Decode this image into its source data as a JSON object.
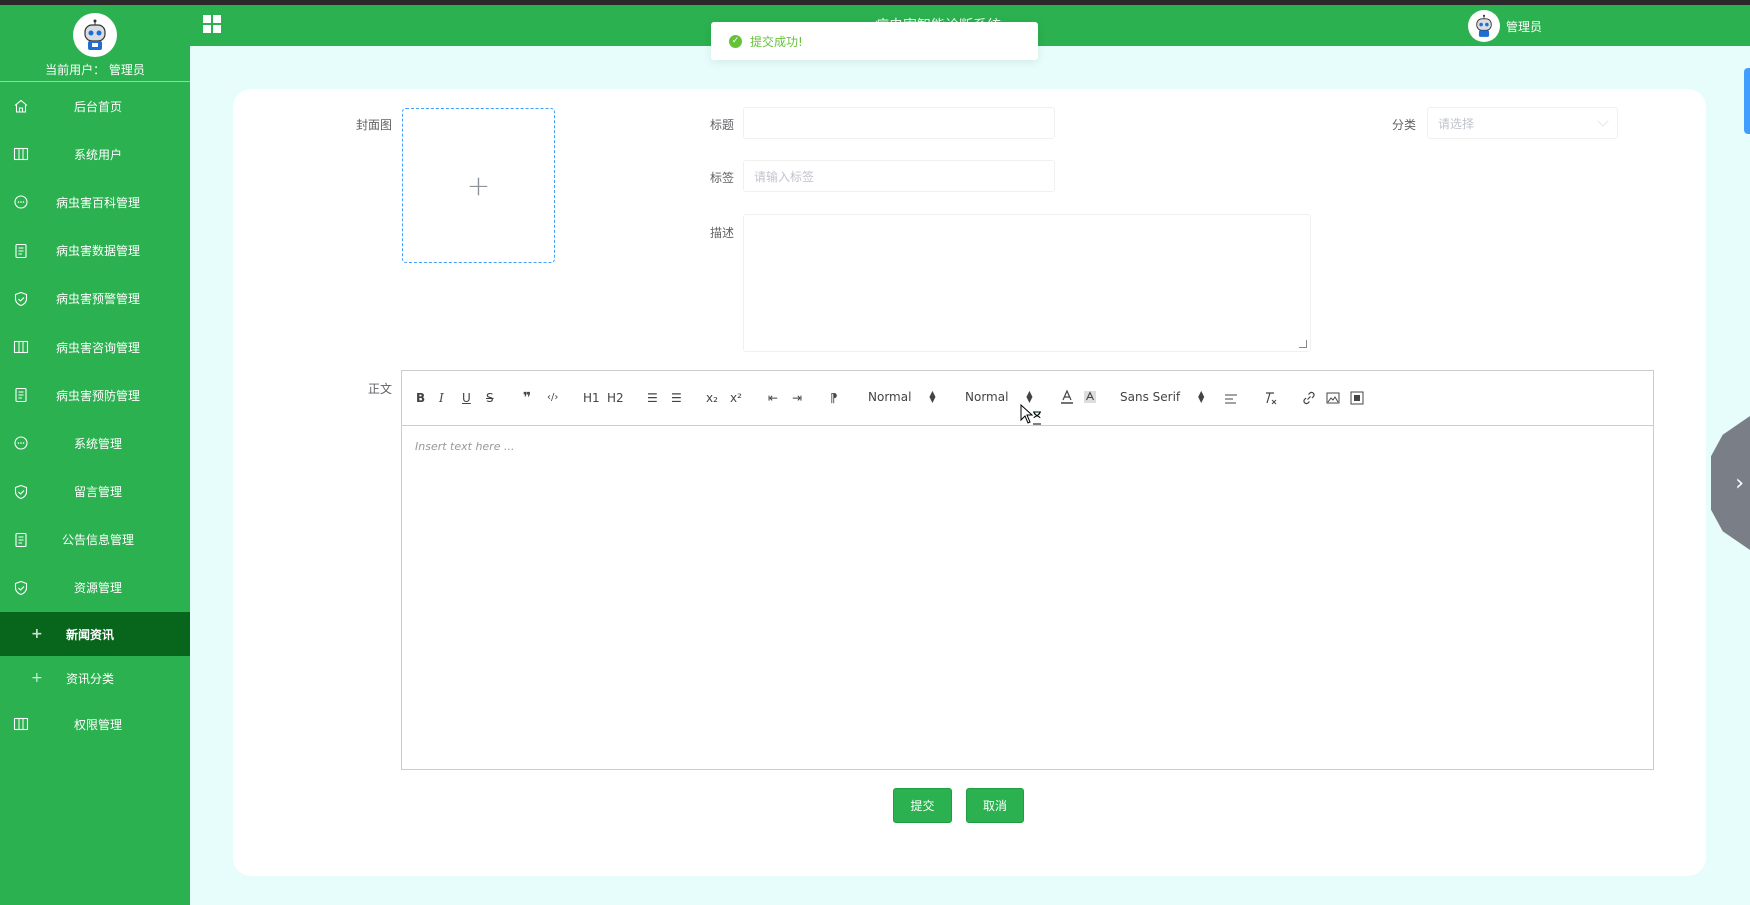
{
  "app": {
    "title": "病虫害智能诊断系统"
  },
  "sidebar": {
    "current_user_label": "当前用户：",
    "current_user_name": "管理员",
    "items": [
      {
        "label": "后台首页",
        "icon": "home-icon"
      },
      {
        "label": "系统用户",
        "icon": "columns-icon"
      },
      {
        "label": "病虫害百科管理",
        "icon": "chat-icon"
      },
      {
        "label": "病虫害数据管理",
        "icon": "document-icon"
      },
      {
        "label": "病虫害预警管理",
        "icon": "shield-icon"
      },
      {
        "label": "病虫害咨询管理",
        "icon": "columns-icon"
      },
      {
        "label": "病虫害预防管理",
        "icon": "document-icon"
      },
      {
        "label": "系统管理",
        "icon": "chat-icon"
      },
      {
        "label": "留言管理",
        "icon": "shield-icon"
      },
      {
        "label": "公告信息管理",
        "icon": "document-icon"
      },
      {
        "label": "资源管理",
        "icon": "shield-icon"
      }
    ],
    "subitems": [
      {
        "label": "新闻资讯",
        "active": true
      },
      {
        "label": "资讯分类",
        "active": false
      }
    ],
    "last_item": {
      "label": "权限管理",
      "icon": "columns-icon"
    }
  },
  "header": {
    "user_name": "管理员"
  },
  "toast": {
    "message": "提交成功!"
  },
  "form": {
    "cover_label": "封面图",
    "title_label": "标题",
    "title_value": "",
    "category_label": "分类",
    "category_placeholder": "请选择",
    "tags_label": "标签",
    "tags_placeholder": "请输入标签",
    "desc_label": "描述",
    "content_label": "正文",
    "editor_placeholder": "Insert text here ...",
    "toolbar": {
      "bold": "B",
      "italic": "I",
      "underline": "U",
      "strike": "S",
      "quote": "❞",
      "code": "‹/›",
      "h1": "H1",
      "h2": "H2",
      "ordered_list": "☰",
      "bullet_list": "☰",
      "subscript": "x₂",
      "superscript": "x²",
      "outdent": "⇤",
      "indent": "⇥",
      "direction": "⁋",
      "size_value": "Normal",
      "header_value": "Normal",
      "font_value": "Sans Serif"
    },
    "submit_label": "提交",
    "cancel_label": "取消"
  },
  "colors": {
    "primary": "#2bb14f",
    "active_menu": "#07651c",
    "background": "#e6fdfb",
    "success": "#67c23a",
    "upload_border": "#409eff"
  }
}
